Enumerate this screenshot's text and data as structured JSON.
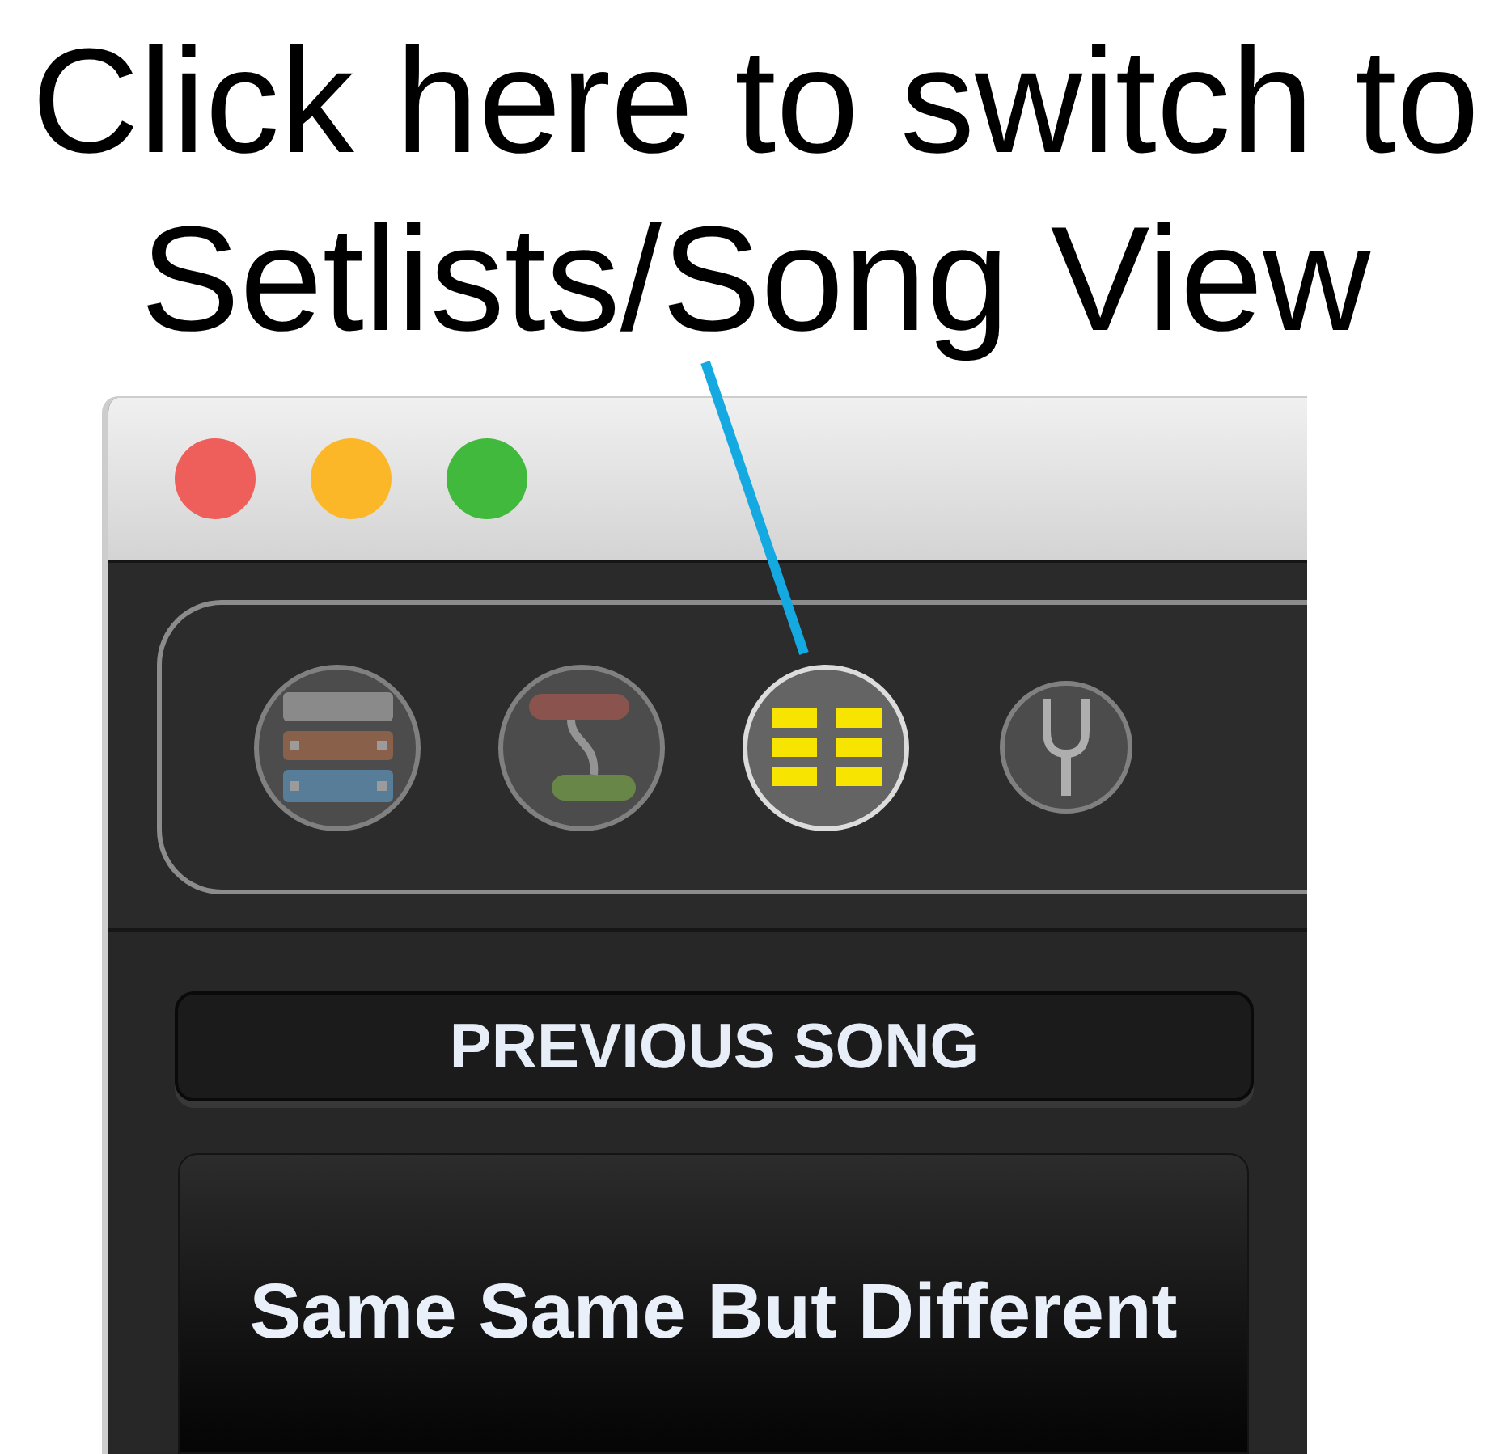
{
  "annotation": {
    "lines": [
      "Click here to switch to",
      "Setlists/Song View"
    ]
  },
  "window": {
    "traffic_lights": [
      {
        "color": "#ee5e5a"
      },
      {
        "color": "#fbb727"
      },
      {
        "color": "#41b93c"
      }
    ]
  },
  "toolbar": {
    "buttons": [
      {
        "kind": "rack",
        "selected": false
      },
      {
        "kind": "routing",
        "selected": false
      },
      {
        "kind": "setlist",
        "selected": true
      },
      {
        "kind": "tuner",
        "selected": false
      }
    ]
  },
  "previous_song": {
    "label": "PREVIOUS SONG"
  },
  "current_song": {
    "title": "Same Same But Different"
  }
}
